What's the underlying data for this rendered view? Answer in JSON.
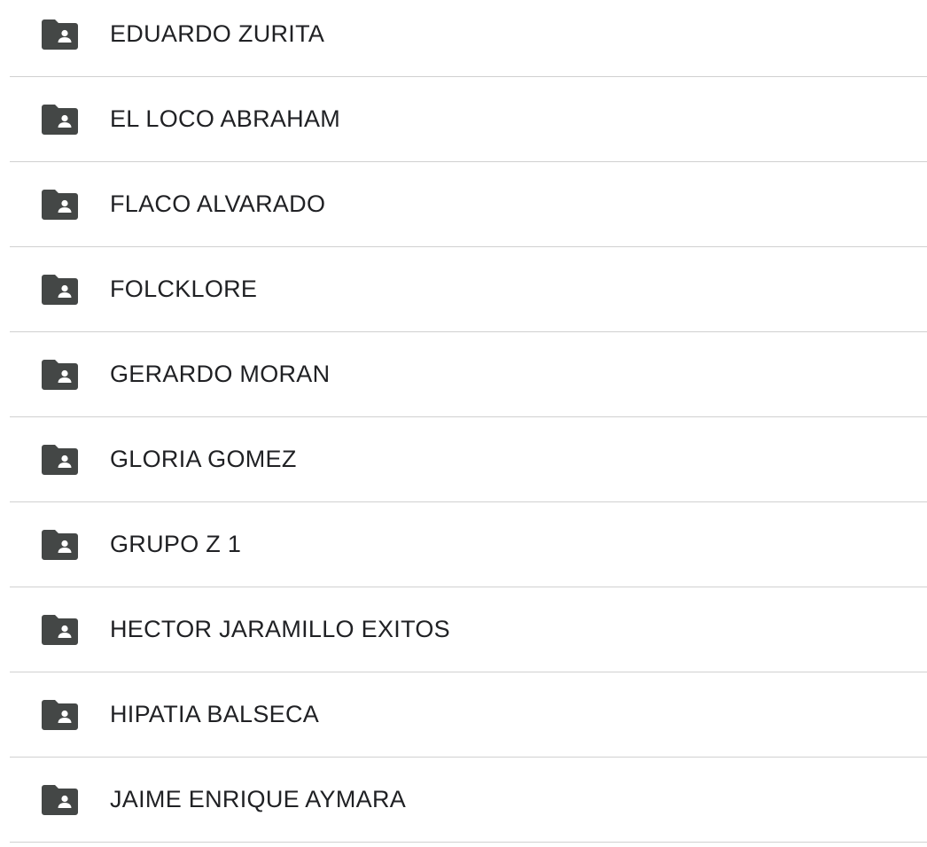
{
  "folders": [
    {
      "name": "EDUARDO ZURITA",
      "icon": "shared-folder-icon"
    },
    {
      "name": "EL LOCO ABRAHAM",
      "icon": "shared-folder-icon"
    },
    {
      "name": "FLACO ALVARADO",
      "icon": "shared-folder-icon"
    },
    {
      "name": "FOLCKLORE",
      "icon": "shared-folder-icon"
    },
    {
      "name": "GERARDO MORAN",
      "icon": "shared-folder-icon"
    },
    {
      "name": "GLORIA GOMEZ",
      "icon": "shared-folder-icon"
    },
    {
      "name": "GRUPO Z 1",
      "icon": "shared-folder-icon"
    },
    {
      "name": "HECTOR JARAMILLO EXITOS",
      "icon": "shared-folder-icon"
    },
    {
      "name": "HIPATIA BALSECA",
      "icon": "shared-folder-icon"
    },
    {
      "name": "JAIME ENRIQUE AYMARA",
      "icon": "shared-folder-icon"
    }
  ],
  "colors": {
    "icon": "#444746",
    "text": "#202124",
    "divider": "#d0d0d0"
  }
}
